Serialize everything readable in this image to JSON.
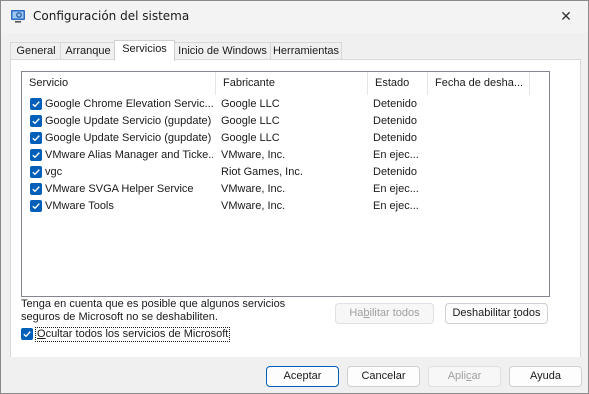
{
  "window": {
    "title": "Configuración del sistema",
    "close_glyph": "✕",
    "app_icon": "system-config-icon"
  },
  "tabs": [
    {
      "label": "General",
      "active": false
    },
    {
      "label": "Arranque",
      "active": false
    },
    {
      "label": "Servicios",
      "active": true
    },
    {
      "label": "Inicio de Windows",
      "active": false
    },
    {
      "label": "Herramientas",
      "active": false
    }
  ],
  "services": {
    "columns": [
      "Servicio",
      "Fabricante",
      "Estado",
      "Fecha de desha..."
    ],
    "rows": [
      {
        "checked": true,
        "name": "Google Chrome Elevation Servic...",
        "vendor": "Google LLC",
        "status": "Detenido",
        "date": ""
      },
      {
        "checked": true,
        "name": "Google Update Servicio (gupdate)",
        "vendor": "Google LLC",
        "status": "Detenido",
        "date": ""
      },
      {
        "checked": true,
        "name": "Google Update Servicio (gupdate)",
        "vendor": "Google LLC",
        "status": "Detenido",
        "date": ""
      },
      {
        "checked": true,
        "name": "VMware Alias Manager and Ticke...",
        "vendor": "VMware, Inc.",
        "status": "En ejec...",
        "date": ""
      },
      {
        "checked": true,
        "name": "vgc",
        "vendor": "Riot Games, Inc.",
        "status": "Detenido",
        "date": ""
      },
      {
        "checked": true,
        "name": "VMware SVGA Helper Service",
        "vendor": "VMware, Inc.",
        "status": "En ejec...",
        "date": ""
      },
      {
        "checked": true,
        "name": "VMware Tools",
        "vendor": "VMware, Inc.",
        "status": "En ejec...",
        "date": ""
      }
    ]
  },
  "note": {
    "line1": "Tenga en cuenta que es posible que algunos servicios",
    "line2": "seguros de Microsoft no se deshabiliten."
  },
  "buttons": {
    "enable_all_pre": "Ha",
    "enable_all_u": "b",
    "enable_all_post": "ilitar todos",
    "disable_all_pre": "Deshabilitar ",
    "disable_all_u": "t",
    "disable_all_post": "odos",
    "ok": "Aceptar",
    "cancel": "Cancelar",
    "apply_pre": "Apli",
    "apply_u": "c",
    "apply_post": "ar",
    "help": "Ayuda"
  },
  "hide_ms": {
    "checked": true,
    "label_u": "O",
    "label_rest": "cultar todos los servicios de Microsoft"
  },
  "colors": {
    "accent": "#005fb8"
  }
}
